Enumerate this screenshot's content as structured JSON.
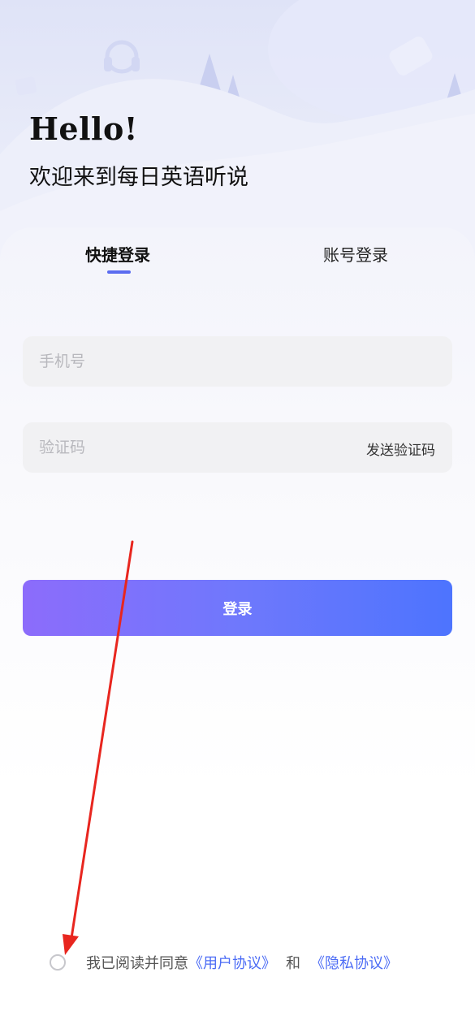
{
  "header": {
    "greeting": "Hello!",
    "subtitle": "欢迎来到每日英语听说"
  },
  "tabs": [
    {
      "label": "快捷登录",
      "active": true
    },
    {
      "label": "账号登录",
      "active": false
    }
  ],
  "form": {
    "phone_placeholder": "手机号",
    "phone_value": "",
    "code_placeholder": "验证码",
    "code_value": "",
    "send_code_label": "发送验证码"
  },
  "login_button_label": "登录",
  "agreement": {
    "checked": false,
    "prefix": "我已阅读并同意",
    "user_agreement": "《用户协议》",
    "and": "和",
    "privacy_policy": "《隐私协议》"
  },
  "colors": {
    "accent": "#5b6cf0",
    "link": "#4c6cf5",
    "button_gradient_start": "#8c6cfb",
    "button_gradient_end": "#4d74fe",
    "annotation_arrow": "#e8261f"
  }
}
